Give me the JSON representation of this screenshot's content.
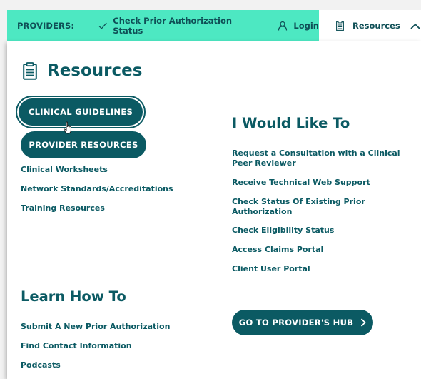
{
  "topbar": {
    "providers_label": "PROVIDERS:",
    "check_status_label": "Check Prior Authorization Status",
    "login_label": "Login",
    "resources_label": "Resources",
    "accent_color": "#4de8c2"
  },
  "panel": {
    "title": "Resources",
    "buttons": {
      "clinical_guidelines": "CLINICAL GUIDELINES",
      "provider_resources": "PROVIDER RESOURCES"
    },
    "left_links": [
      "Clinical Worksheets",
      "Network Standards/Accreditations",
      "Training Resources"
    ],
    "would_like_heading": "I Would Like To",
    "would_like_links": [
      "Request a Consultation with a Clinical Peer Reviewer",
      "Receive Technical Web Support",
      "Check Status Of Existing Prior Authorization",
      "Check Eligibility Status",
      "Access Claims Portal",
      "Client User Portal"
    ],
    "learn_heading": "Learn How To",
    "learn_links": [
      "Submit A New Prior Authorization",
      "Find Contact Information",
      "Podcasts"
    ],
    "hub_button": "GO TO PROVIDER'S HUB",
    "brand_color": "#0b5a63"
  },
  "icons": {
    "check": "check-icon",
    "user": "user-icon",
    "document": "clipboard-icon",
    "chevron_up": "chevron-up-icon",
    "chevron_right": "chevron-right-icon",
    "cursor": "hand-cursor-icon"
  }
}
